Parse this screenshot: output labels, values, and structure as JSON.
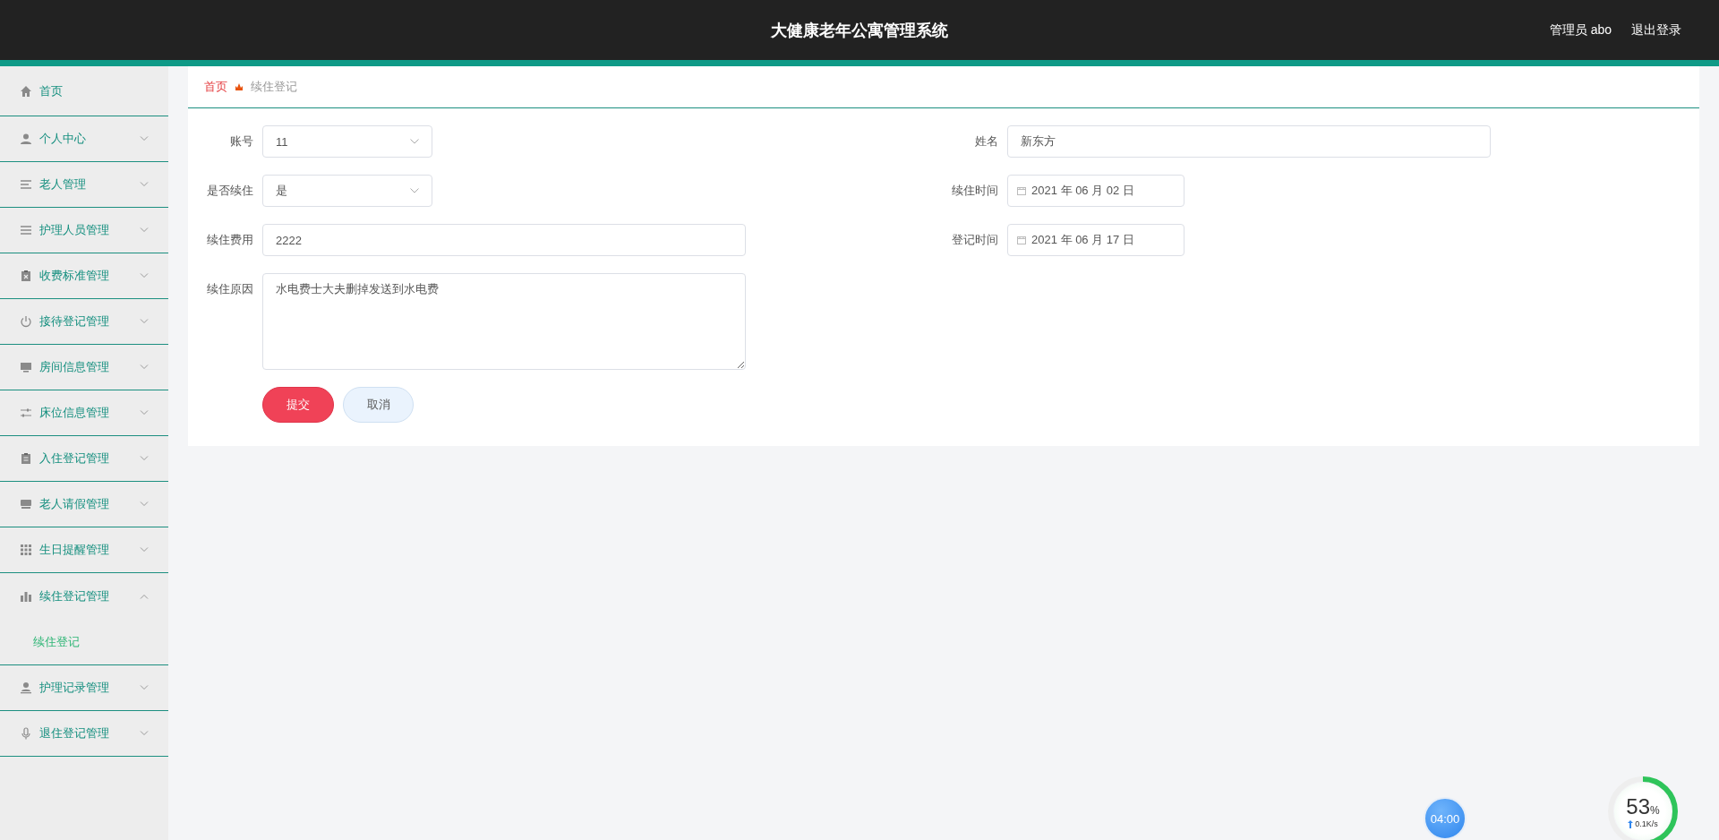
{
  "header": {
    "title": "大健康老年公寓管理系统",
    "user": "管理员 abo",
    "logout": "退出登录"
  },
  "sidebar": {
    "items": [
      {
        "label": "首页",
        "has_arrow": false
      },
      {
        "label": "个人中心",
        "expanded": false,
        "has_arrow": true
      },
      {
        "label": "老人管理",
        "expanded": false,
        "has_arrow": true
      },
      {
        "label": "护理人员管理",
        "expanded": false,
        "has_arrow": true
      },
      {
        "label": "收费标准管理",
        "expanded": false,
        "has_arrow": true
      },
      {
        "label": "接待登记管理",
        "expanded": false,
        "has_arrow": true
      },
      {
        "label": "房间信息管理",
        "expanded": false,
        "has_arrow": true
      },
      {
        "label": "床位信息管理",
        "expanded": false,
        "has_arrow": true
      },
      {
        "label": "入住登记管理",
        "expanded": false,
        "has_arrow": true
      },
      {
        "label": "老人请假管理",
        "expanded": false,
        "has_arrow": true
      },
      {
        "label": "生日提醒管理",
        "expanded": false,
        "has_arrow": true
      },
      {
        "label": "续住登记管理",
        "expanded": true,
        "has_arrow": true,
        "children": [
          {
            "label": "续住登记",
            "selected": true
          }
        ]
      },
      {
        "label": "护理记录管理",
        "expanded": false,
        "has_arrow": true
      },
      {
        "label": "退住登记管理",
        "expanded": false,
        "has_arrow": true
      }
    ]
  },
  "breadcrumb": [
    "首页",
    "续住登记"
  ],
  "form": {
    "left": [
      {
        "kind": "select",
        "label": "账号",
        "value": "11"
      },
      {
        "kind": "select",
        "label": "是否续住",
        "value": "是"
      },
      {
        "kind": "text",
        "label": "续住费用",
        "value": "2222"
      },
      {
        "kind": "textarea",
        "label": "续住原因",
        "value": "水电费士大夫删掉发送到水电费"
      }
    ],
    "right": [
      {
        "kind": "text",
        "label": "姓名",
        "value": "新东方"
      },
      {
        "kind": "date",
        "label": "续住时间",
        "value": "2021 年 06 月 02 日"
      },
      {
        "kind": "date",
        "label": "登记时间",
        "value": "2021 年 06 月 17 日"
      }
    ],
    "buttons": [
      {
        "label": "提交",
        "kind": "primary"
      },
      {
        "label": "取消",
        "kind": "secondary"
      }
    ]
  },
  "widgets": {
    "timer": "04:00",
    "meter": {
      "percent": "53",
      "unit": "%",
      "level": 0.53,
      "speed": "0.1K/s"
    }
  }
}
